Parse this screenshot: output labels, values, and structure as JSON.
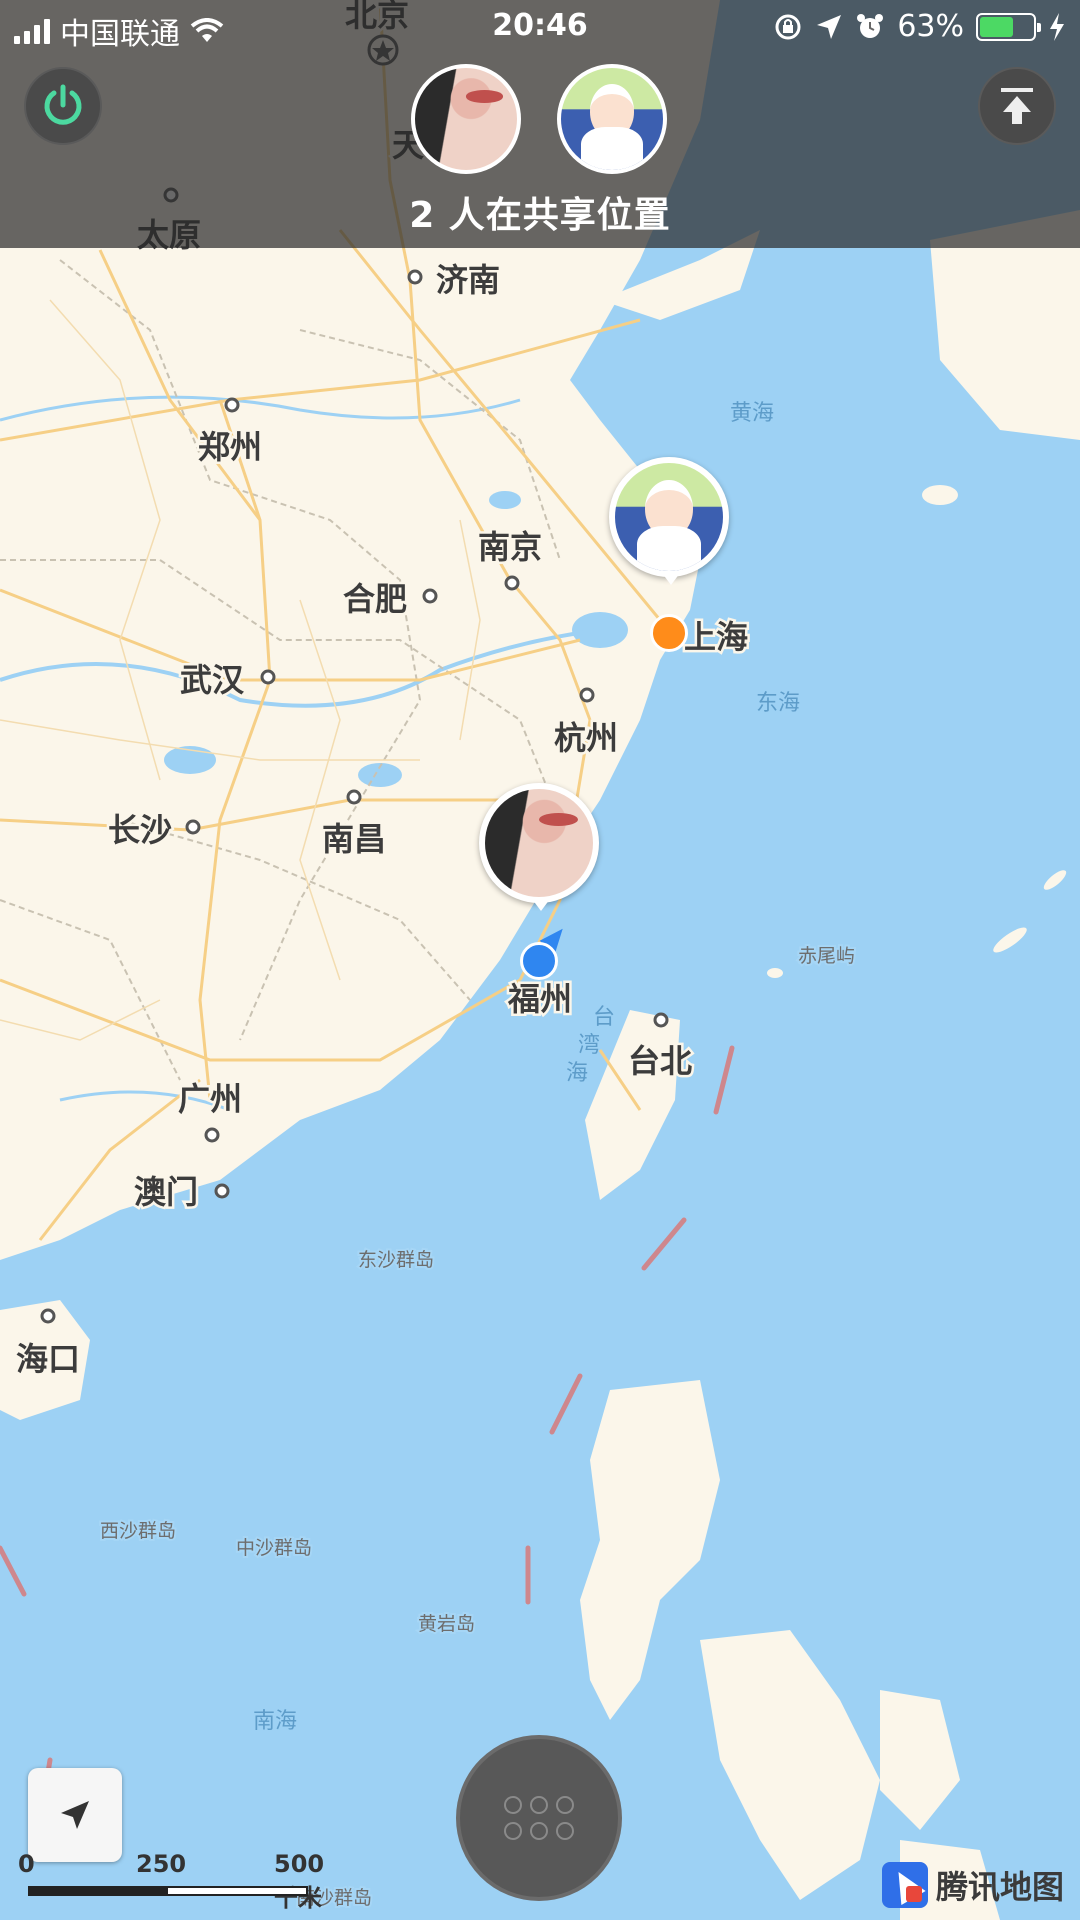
{
  "status_bar": {
    "carrier": "中国联通",
    "time": "20:46",
    "battery": "63%",
    "battery_level": 0.63
  },
  "share_bar": {
    "text": "2 人在共享位置",
    "avatars": [
      "girl-avatar",
      "anime-avatar"
    ]
  },
  "map": {
    "cities": {
      "beijing": "北京",
      "tianjin": "天",
      "taiyuan": "太原",
      "jinan": "济南",
      "zhengzhou": "郑州",
      "nanjing": "南京",
      "hefei": "合肥",
      "shanghai": "上海",
      "wuhan": "武汉",
      "hangzhou": "杭州",
      "changsha": "长沙",
      "nanchang": "南昌",
      "fuzhou": "福州",
      "taipei": "台北",
      "guangzhou": "广州",
      "macau": "澳门",
      "haikou": "海口"
    },
    "seas": {
      "yellow_sea": "黄海",
      "east_sea": "东海",
      "south_sea": "南海",
      "strait_1": "台",
      "strait_2": "湾",
      "strait_3": "海"
    },
    "islands": {
      "chiwei": "赤尾屿",
      "dongsha": "东沙群岛",
      "xisha": "西沙群岛",
      "zhongsha": "中沙群岛",
      "huangyan": "黄岩岛",
      "nansha": "南沙群岛"
    }
  },
  "scale": {
    "zero": "0",
    "mid": "250",
    "end": "500 千米"
  },
  "brand": "腾讯地图",
  "colors": {
    "land": "#fbf6ea",
    "sea": "#9dd1f4",
    "road": "#f6cf86",
    "border": "#c9c2b2",
    "user_dot_orange": "#ff8c1a",
    "user_dot_blue": "#2f86f0",
    "power_icon": "#4cd9a0"
  }
}
